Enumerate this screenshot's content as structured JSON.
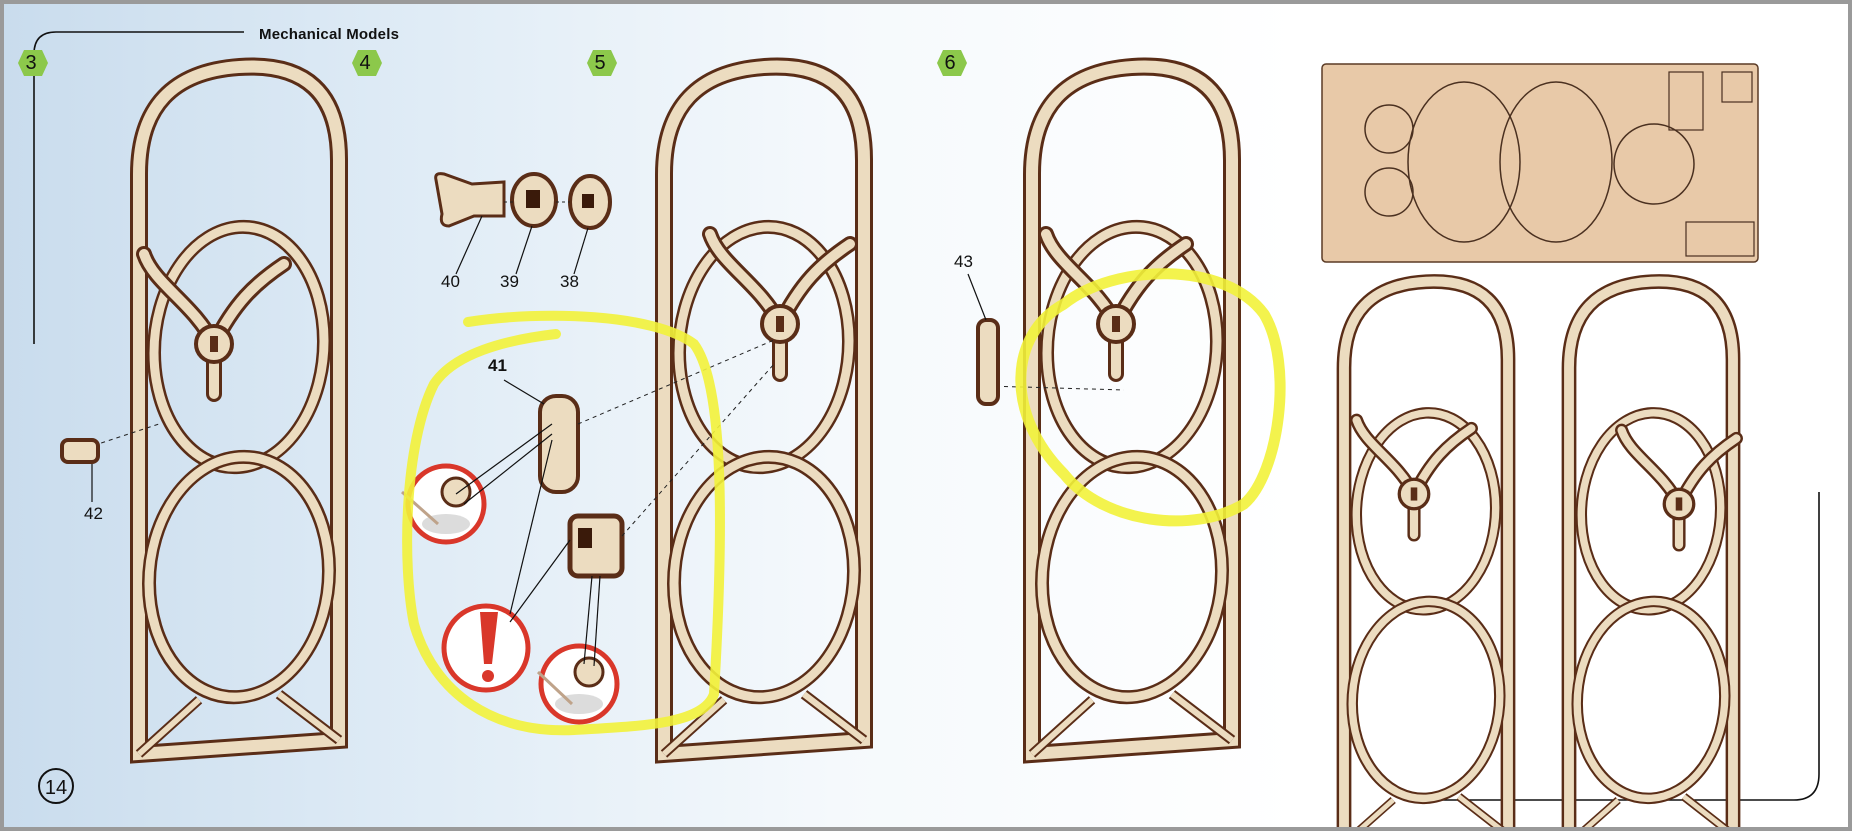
{
  "header": {
    "title": "Mechanical Models"
  },
  "steps": [
    {
      "number": "3"
    },
    {
      "number": "4"
    },
    {
      "number": "5"
    },
    {
      "number": "6"
    }
  ],
  "parts": {
    "p38": "38",
    "p39": "39",
    "p40": "40",
    "p41": "41",
    "p42": "42",
    "p43": "43"
  },
  "footer": {
    "page_number": "14"
  },
  "colors": {
    "wood": "#ecdcc0",
    "wood_edge": "#5a2d17",
    "highlight": "#f2f23a",
    "warning": "#d9372a",
    "step_badge": "#7fc241"
  }
}
